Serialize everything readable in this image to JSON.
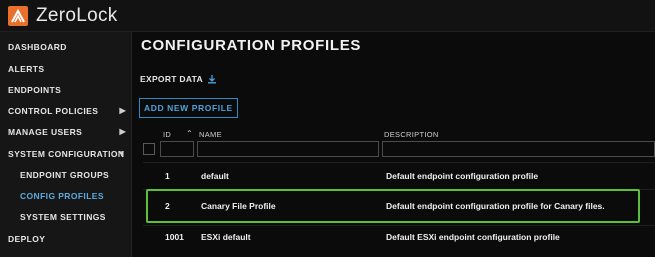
{
  "app": {
    "title": "ZeroLock"
  },
  "sidebar": {
    "items": [
      {
        "label": "DASHBOARD"
      },
      {
        "label": "ALERTS"
      },
      {
        "label": "ENDPOINTS"
      },
      {
        "label": "CONTROL POLICIES",
        "chevron": "chevron-right-icon"
      },
      {
        "label": "MANAGE USERS",
        "chevron": "chevron-right-icon"
      },
      {
        "label": "SYSTEM CONFIGURATION",
        "chevron": "chevron-down-icon"
      },
      {
        "label": "ENDPOINT GROUPS"
      },
      {
        "label": "CONFIG PROFILES",
        "active": true
      },
      {
        "label": "SYSTEM SETTINGS"
      },
      {
        "label": "DEPLOY"
      }
    ]
  },
  "main": {
    "title": "CONFIGURATION PROFILES",
    "export_label": "EXPORT DATA",
    "add_button_label": "ADD NEW PROFILE",
    "columns": {
      "id": "ID",
      "name": "NAME",
      "description": "DESCRIPTION"
    },
    "rows": [
      {
        "id": "1",
        "name": "default",
        "description": "Default endpoint configuration profile"
      },
      {
        "id": "2",
        "name": "Canary File Profile",
        "description": "Default endpoint configuration profile for Canary files.",
        "highlighted": true
      },
      {
        "id": "1001",
        "name": "ESXi default",
        "description": "Default ESXi endpoint configuration profile"
      }
    ]
  },
  "colors": {
    "accent": "#4ea3dc",
    "highlight": "#5bbf3a",
    "logo": "#e8702a"
  }
}
